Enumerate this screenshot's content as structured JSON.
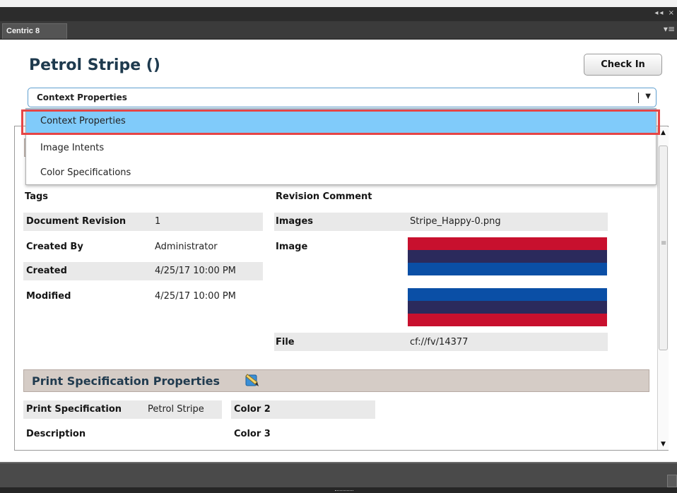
{
  "window": {
    "controls_glyph": "◂◂ ×"
  },
  "panel_tab": {
    "label": "Centric 8",
    "menu_icon": "panel-menu-icon"
  },
  "page": {
    "title": "Petrol Stripe ()"
  },
  "toolbar": {
    "check_in_label": "Check In"
  },
  "context_select": {
    "value": "Context Properties",
    "arrow": "▼"
  },
  "dropdown": {
    "options": [
      "Context Properties",
      "Image Intents",
      "Color Specifications"
    ],
    "selected_index": 0
  },
  "scrollbar": {
    "up": "▲",
    "down": "▼",
    "grip": "≡"
  },
  "properties": {
    "tags_label": "Tags",
    "revision_comment_label": "Revision Comment",
    "document_revision_label": "Document Revision",
    "document_revision_value": "1",
    "images_label": "Images",
    "images_value": "Stripe_Happy-0.png",
    "created_by_label": "Created By",
    "created_by_value": "Administrator",
    "image_label": "Image",
    "created_label": "Created",
    "created_value": "4/25/17 10:00 PM",
    "modified_label": "Modified",
    "modified_value": "4/25/17 10:00 PM",
    "file_label": "File",
    "file_value": "cf://fv/14377"
  },
  "swatch_colors": {
    "red": "#c8102e",
    "navy": "#2b2a5c",
    "blue": "#0a4fa6"
  },
  "print_spec": {
    "title": "Print Specification Properties",
    "edit_icon": "edit-pencil-icon",
    "print_specification_label": "Print Specification",
    "print_specification_value": "Petrol Stripe",
    "color2_label": "Color 2",
    "description_label": "Description",
    "color3_label": "Color 3"
  }
}
